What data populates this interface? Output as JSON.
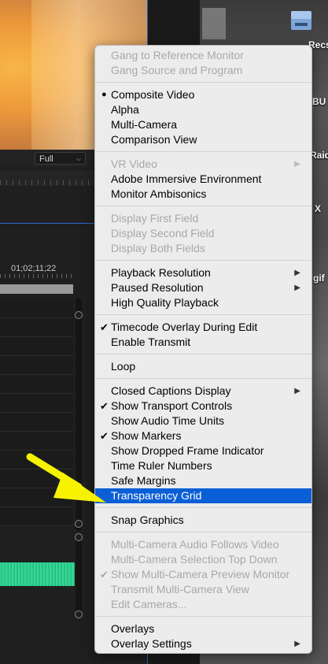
{
  "background": {
    "zoom_select_value": "Full",
    "timecode": "01;02;11;22",
    "desktop_labels": [
      "Recs",
      "BU",
      "Raid",
      "X",
      "gif"
    ]
  },
  "colors": {
    "menu_bg": "#ececec",
    "highlight": "#0b5fd6",
    "disabled_text": "#a8a8a8",
    "annotation_arrow": "#f7f300",
    "audio_waveform": "#2fcf8e"
  },
  "menu": {
    "items": [
      {
        "label": "Gang to Reference Monitor",
        "disabled": true
      },
      {
        "label": "Gang Source and Program",
        "disabled": true
      },
      {
        "label": "Composite Video",
        "bullet": true
      },
      {
        "label": "Alpha"
      },
      {
        "label": "Multi-Camera"
      },
      {
        "label": "Comparison View"
      },
      {
        "label": "VR Video",
        "disabled": true,
        "submenu": true
      },
      {
        "label": "Adobe Immersive Environment"
      },
      {
        "label": "Monitor Ambisonics"
      },
      {
        "label": "Display First Field",
        "disabled": true
      },
      {
        "label": "Display Second Field",
        "disabled": true
      },
      {
        "label": "Display Both Fields",
        "disabled": true
      },
      {
        "label": "Playback Resolution",
        "submenu": true
      },
      {
        "label": "Paused Resolution",
        "submenu": true
      },
      {
        "label": "High Quality Playback"
      },
      {
        "label": "Timecode Overlay During Edit",
        "checked": true
      },
      {
        "label": "Enable Transmit"
      },
      {
        "label": "Loop"
      },
      {
        "label": "Closed Captions Display",
        "submenu": true
      },
      {
        "label": "Show Transport Controls",
        "checked": true
      },
      {
        "label": "Show Audio Time Units"
      },
      {
        "label": "Show Markers",
        "checked": true
      },
      {
        "label": "Show Dropped Frame Indicator"
      },
      {
        "label": "Time Ruler Numbers"
      },
      {
        "label": "Safe Margins"
      },
      {
        "label": "Transparency Grid",
        "highlighted": true
      },
      {
        "label": "Snap Graphics"
      },
      {
        "label": "Multi-Camera Audio Follows Video",
        "disabled": true
      },
      {
        "label": "Multi-Camera Selection Top Down",
        "disabled": true
      },
      {
        "label": "Show Multi-Camera Preview Monitor",
        "disabled": true,
        "checked": true
      },
      {
        "label": "Transmit Multi-Camera View",
        "disabled": true
      },
      {
        "label": "Edit Cameras...",
        "disabled": true
      },
      {
        "label": "Overlays"
      },
      {
        "label": "Overlay Settings",
        "submenu": true
      }
    ]
  }
}
